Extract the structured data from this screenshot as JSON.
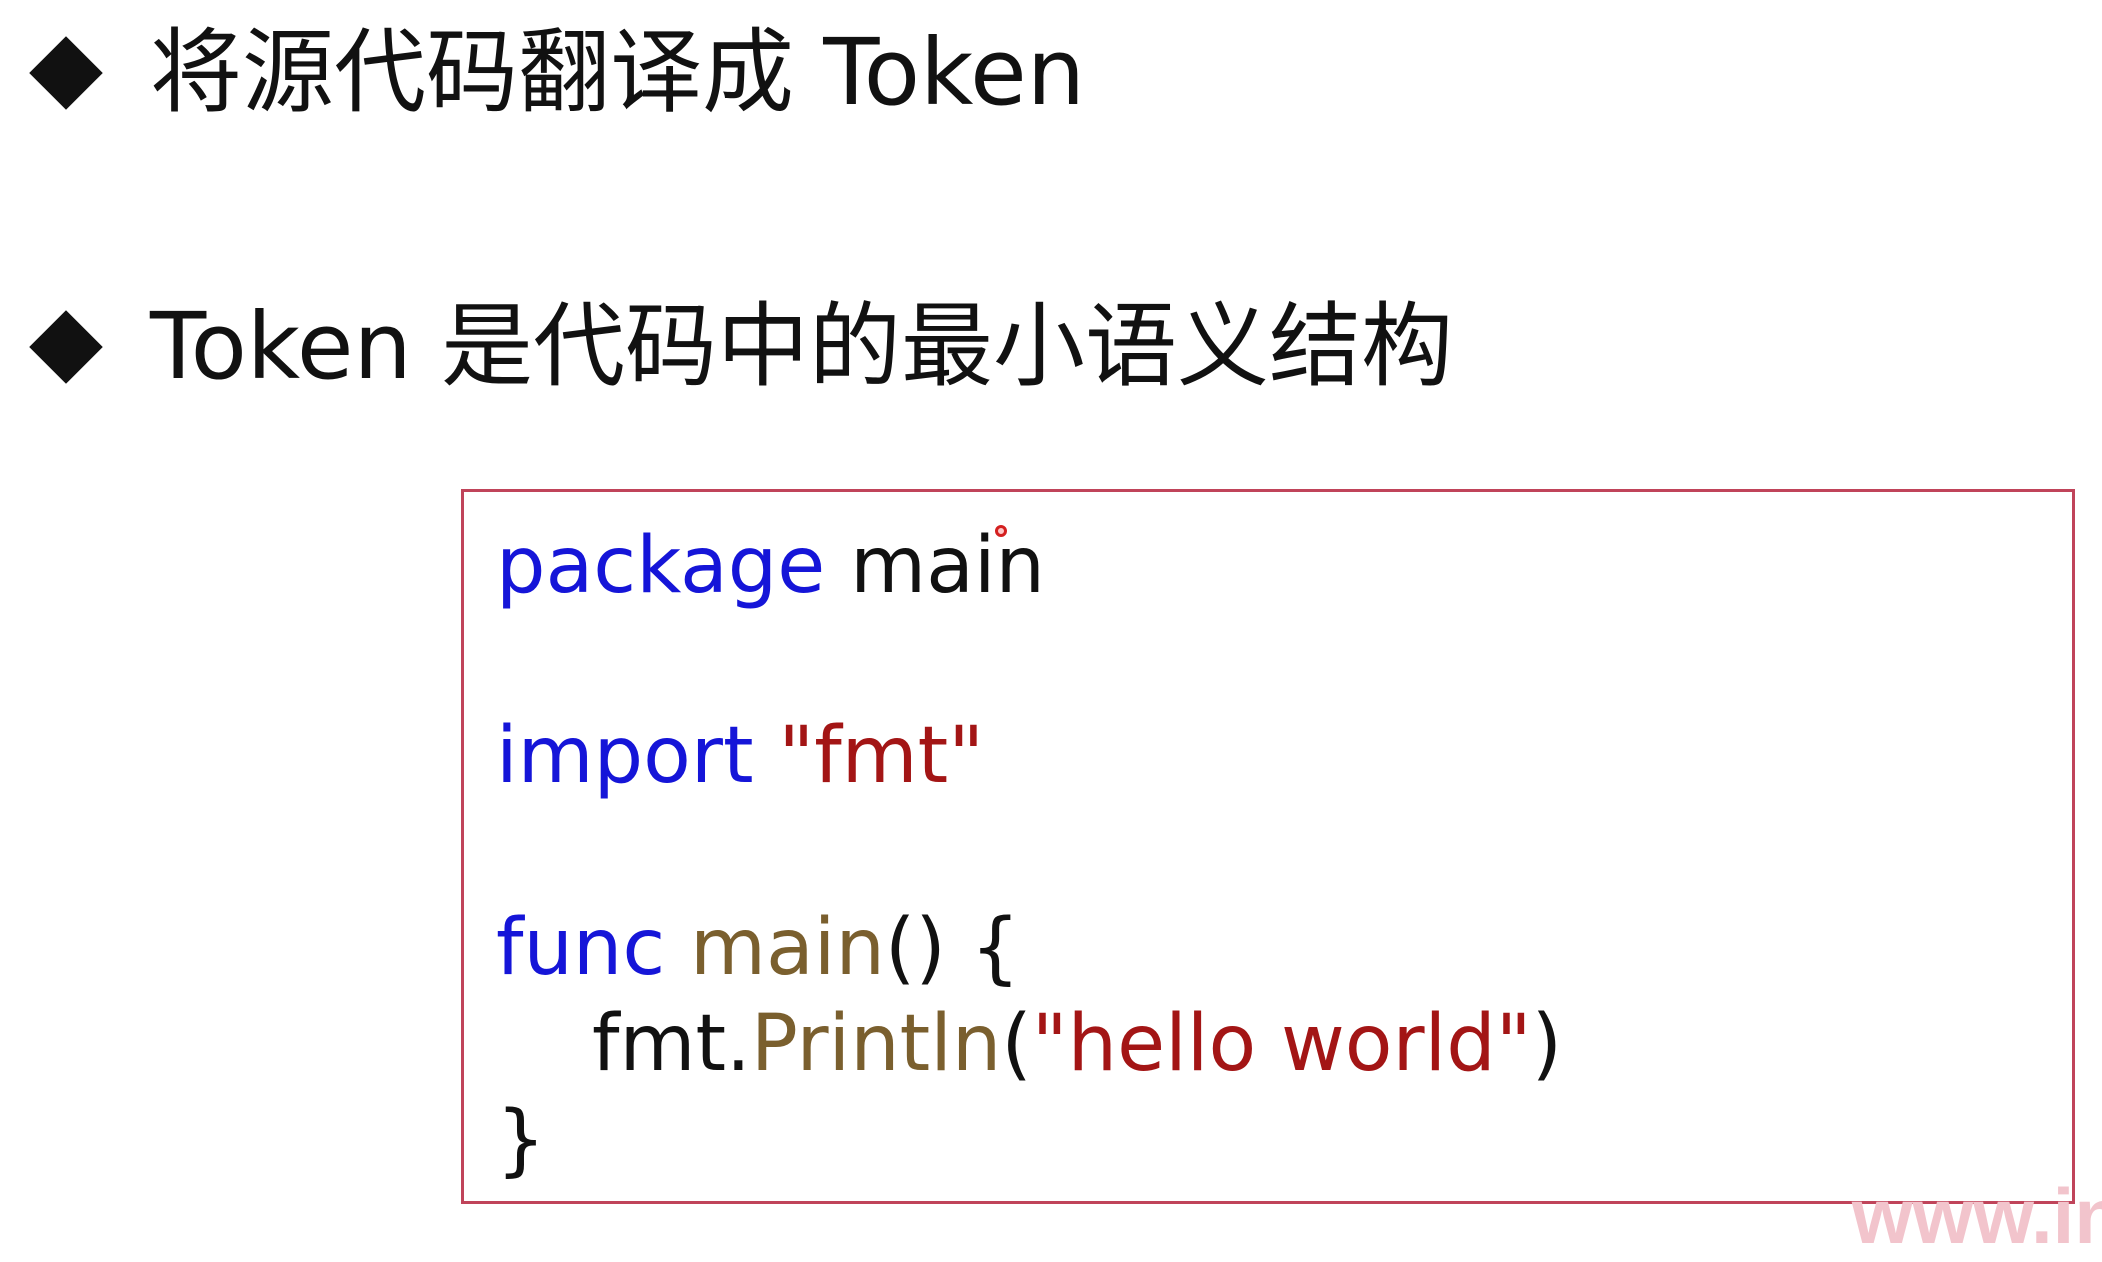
{
  "bullets": [
    {
      "text": "将源代码翻译成 Token"
    },
    {
      "text": "Token 是代码中的最小语义结构"
    }
  ],
  "code": {
    "line1": {
      "keyword": "package",
      "rest": " main"
    },
    "line2": {
      "keyword": "import",
      "space": " ",
      "string": "\"fmt\""
    },
    "line3": {
      "keyword": "func",
      "space": " ",
      "name": "main",
      "rest": "() {"
    },
    "line4": {
      "receiver": "fmt.",
      "method": "Println",
      "open": "(",
      "string": "\"hello world\"",
      "close": ")"
    },
    "line5": {
      "text": "}"
    }
  },
  "watermark": {
    "text": "www.in"
  },
  "colors": {
    "keyword": "#1515d8",
    "string": "#a31515",
    "function": "#7a5f2e",
    "border": "#c0445a"
  }
}
